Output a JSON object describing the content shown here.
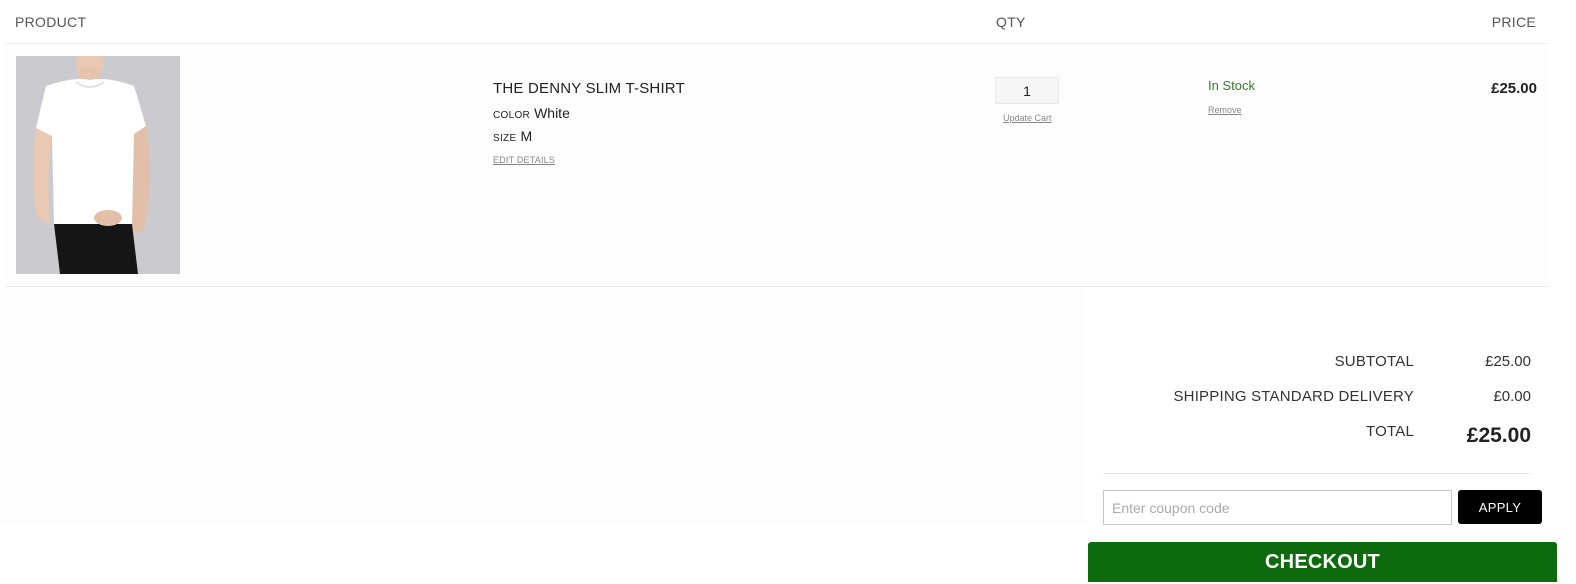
{
  "columns": {
    "product": "PRODUCT",
    "qty": "QTY",
    "price": "PRICE"
  },
  "item": {
    "image_alt": "man-wearing-white-t-shirt",
    "name": "THE DENNY SLIM T-SHIRT",
    "color_label": "COLOR",
    "color_value": "White",
    "size_label": "SIZE",
    "size_value": "M",
    "edit_link": "EDIT DETAILS",
    "quantity": "1",
    "update_link": "Update Cart",
    "stock": "In Stock",
    "remove_link": "Remove",
    "price": "£25.00"
  },
  "summary": {
    "subtotal_label": "SUBTOTAL",
    "subtotal_value": "£25.00",
    "shipping_label": "SHIPPING STANDARD DELIVERY",
    "shipping_value": "£0.00",
    "total_label": "TOTAL",
    "total_value": "£25.00"
  },
  "coupon": {
    "placeholder": "Enter coupon code",
    "apply_label": "APPLY"
  },
  "checkout_label": "CHECKOUT",
  "colors": {
    "accent_green": "#0d6a0d",
    "stock_green": "#3a7a30",
    "apply_black": "#000000"
  }
}
